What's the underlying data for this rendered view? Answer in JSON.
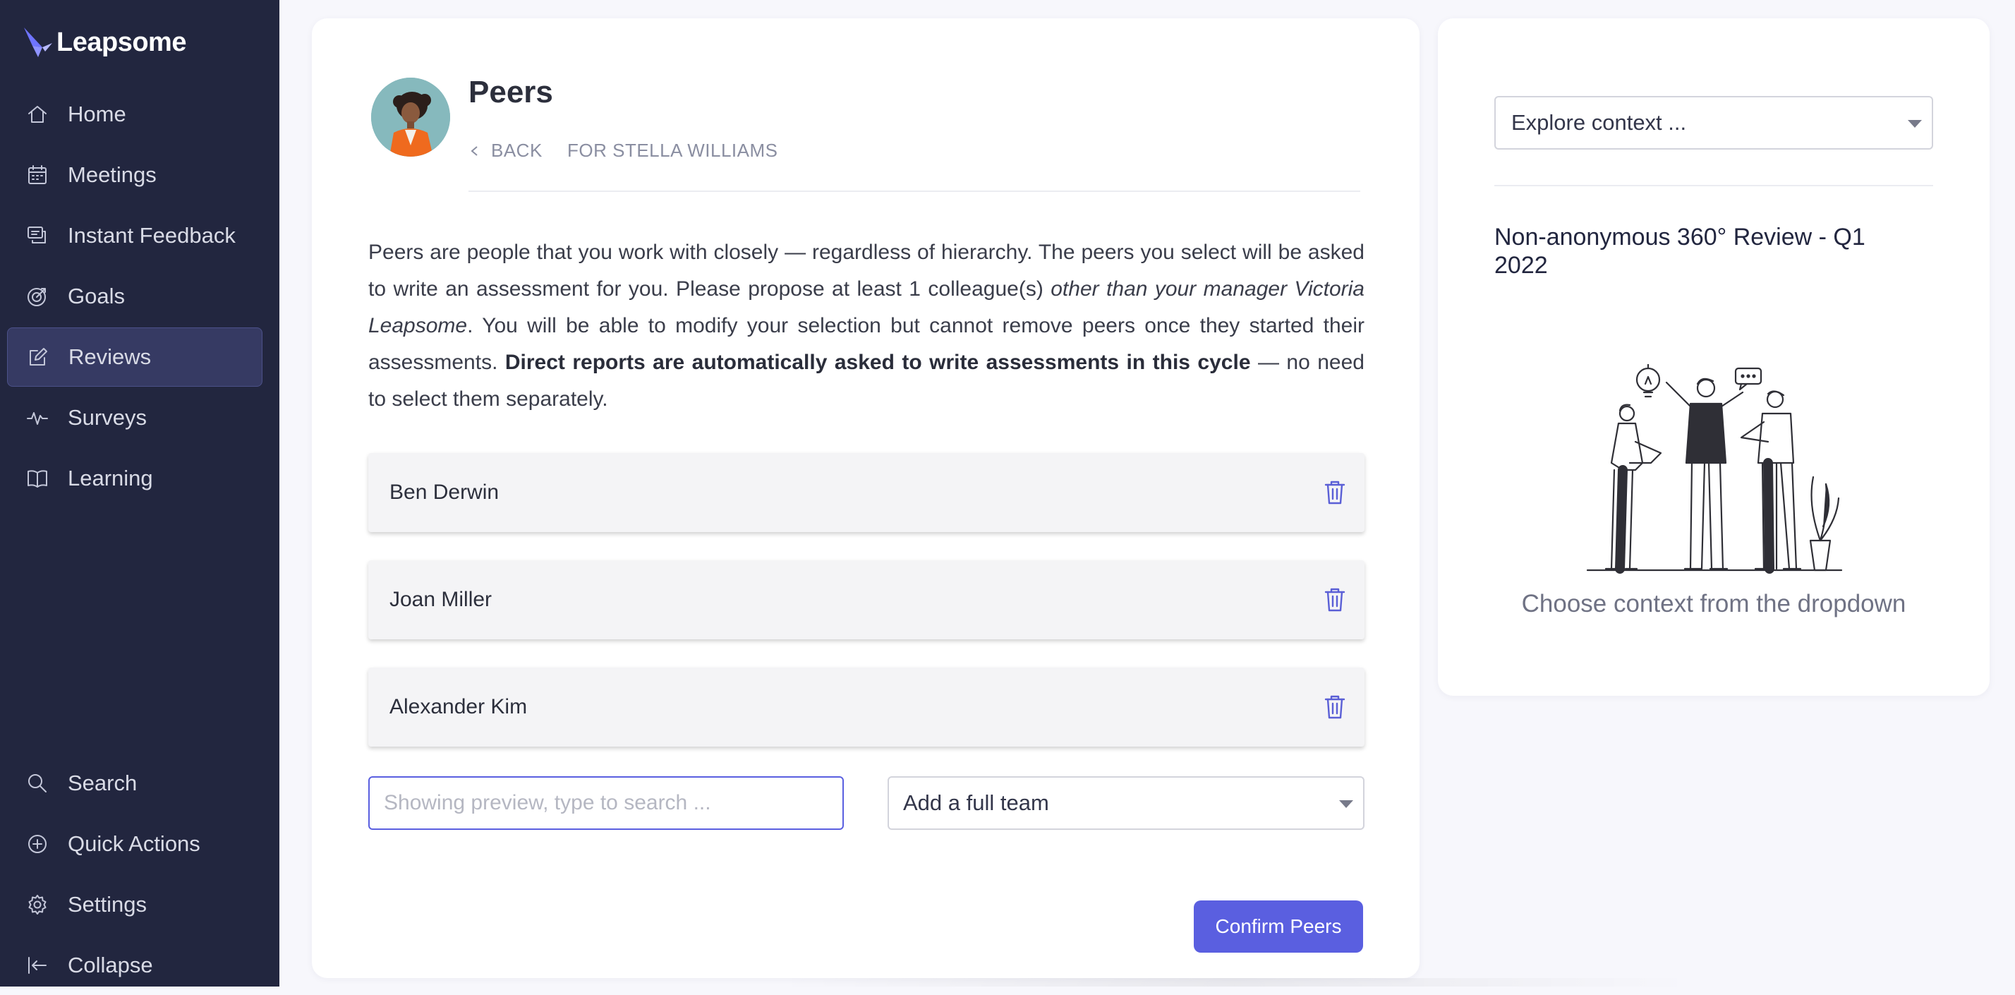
{
  "app": {
    "brand": "Leapsome"
  },
  "sidebar": {
    "items": [
      {
        "label": "Home",
        "icon": "home-icon"
      },
      {
        "label": "Meetings",
        "icon": "calendar-icon"
      },
      {
        "label": "Instant Feedback",
        "icon": "chat-icon"
      },
      {
        "label": "Goals",
        "icon": "target-icon"
      },
      {
        "label": "Reviews",
        "icon": "edit-icon",
        "active": true
      },
      {
        "label": "Surveys",
        "icon": "pulse-icon"
      },
      {
        "label": "Learning",
        "icon": "book-icon"
      }
    ],
    "bottom_items": [
      {
        "label": "Search",
        "icon": "search-icon"
      },
      {
        "label": "Quick Actions",
        "icon": "plus-circle-icon"
      },
      {
        "label": "Settings",
        "icon": "gear-icon"
      },
      {
        "label": "Collapse",
        "icon": "collapse-icon"
      }
    ]
  },
  "main": {
    "title": "Peers",
    "back_label": "BACK",
    "for_label": "FOR STELLA WILLIAMS",
    "description": {
      "part1": "Peers are people that you work with closely — regardless of hierarchy. The peers you select will be asked to write an assessment for you. Please propose at least 1 colleague(s) ",
      "italic": "other than your manager Victoria Leapsome",
      "part2": ". You will be able to modify your selection but cannot remove peers once they started their assessments. ",
      "bold": "Direct reports are automatically asked to write assessments in this cycle",
      "part3": " — no need to select them separately."
    },
    "peers": [
      {
        "name": "Ben Derwin"
      },
      {
        "name": "Joan Miller"
      },
      {
        "name": "Alexander Kim"
      }
    ],
    "search_placeholder": "Showing preview, type to search ...",
    "team_select_value": "Add a full team",
    "confirm_label": "Confirm Peers"
  },
  "side": {
    "context_select_value": "Explore context ...",
    "cycle_title": "Non-anonymous 360° Review - Q1 2022",
    "empty_hint": "Choose context from the dropdown"
  },
  "colors": {
    "sidebar_bg": "#22263f",
    "accent": "#5a5fe0",
    "page_bg": "#f7f7fc"
  }
}
